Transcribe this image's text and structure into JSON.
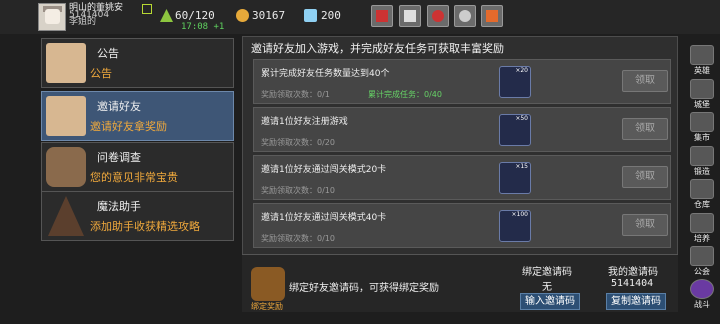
{
  "header": {
    "player_name": "明山的董姚安",
    "player_id": "5141404",
    "player_sub": "李姐的",
    "timer": "17:08 +1",
    "stamina": "60/120",
    "gold": "30167",
    "gems": "200",
    "toolbar_icons": [
      "shop-cart-icon",
      "mail-icon",
      "gift-camera-icon",
      "settings-gear-icon",
      "event-icon"
    ]
  },
  "sidebar": {
    "items": [
      {
        "title": "公告",
        "subtitle": "公告",
        "icon": "notice-envelope-icon"
      },
      {
        "title": "邀请好友",
        "subtitle": "邀请好友拿奖励",
        "icon": "invite-envelope-icon"
      },
      {
        "title": "问卷调查",
        "subtitle": "您的意见非常宝贵",
        "icon": "survey-dog-icon"
      },
      {
        "title": "魔法助手",
        "subtitle": "添加助手收获精选攻略",
        "icon": "wizard-hat-icon"
      }
    ]
  },
  "main": {
    "title": "邀请好友加入游戏，并完成好友任务可获取丰富奖励",
    "tasks": [
      {
        "title": "累计完成好友任务数量达到40个",
        "count": "奖励领取次数：0/1",
        "progress": "累计完成任务：0/40",
        "reward_qty": "×20",
        "reward": "anchor-icon",
        "button": "领取"
      },
      {
        "title": "邀请1位好友注册游戏",
        "count": "奖励领取次数：0/20",
        "progress": "",
        "reward_qty": "×50",
        "reward": "diamond-icon",
        "button": "领取"
      },
      {
        "title": "邀请1位好友通过闯关模式20卡",
        "count": "奖励领取次数：0/10",
        "progress": "",
        "reward_qty": "×15",
        "reward": "gold-egg-icon",
        "button": "领取"
      },
      {
        "title": "邀请1位好友通过闯关模式40卡",
        "count": "奖励领取次数：0/10",
        "progress": "",
        "reward_qty": "×100",
        "reward": "diamond-icon",
        "button": "领取"
      }
    ]
  },
  "bottom": {
    "caption": "绑定奖励",
    "text": "绑定好友邀请码，可获得绑定奖励",
    "bound_label": "绑定邀请码",
    "bound_value": "无",
    "input_button": "输入邀请码",
    "my_label": "我的邀请码",
    "my_value": "5141404",
    "copy_button": "复制邀请码"
  },
  "nav": [
    {
      "label": "英雄",
      "icon": "hero-icon"
    },
    {
      "label": "城堡",
      "icon": "castle-icon"
    },
    {
      "label": "集市",
      "icon": "market-icon"
    },
    {
      "label": "锻造",
      "icon": "forge-icon"
    },
    {
      "label": "仓库",
      "icon": "warehouse-icon"
    },
    {
      "label": "培养",
      "icon": "train-icon"
    },
    {
      "label": "公会",
      "icon": "guild-icon"
    },
    {
      "label": "战斗",
      "icon": "battle-icon"
    }
  ],
  "colors": {
    "accent_orange": "#f0a93c",
    "progress_green": "#66d266",
    "active_blue": "#3e5676"
  }
}
